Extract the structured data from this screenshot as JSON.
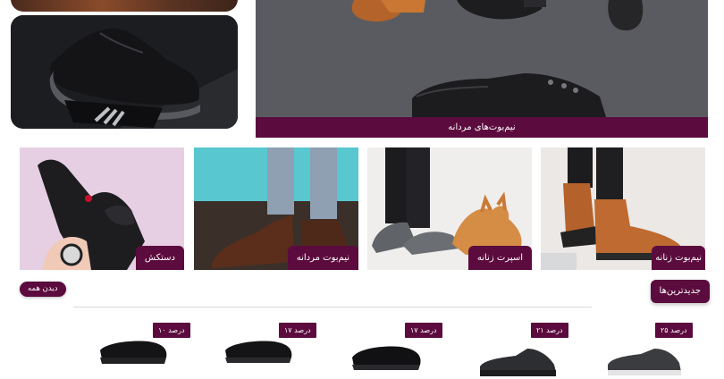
{
  "hero": {
    "caption": "نیم‌بوت‌های مردانه"
  },
  "categories": [
    {
      "label": "نیم‌بوت زنانه"
    },
    {
      "label": "اسپرت زنانه"
    },
    {
      "label": "نیم‌بوت مردانه"
    },
    {
      "label": "دستکش"
    }
  ],
  "newest": {
    "title": "جدیدترین‌ها",
    "see_all": "دیدن همه",
    "products": [
      {
        "discount": "۲۵ درصد"
      },
      {
        "discount": "۲۱ درصد"
      },
      {
        "discount": "۱۷ درصد"
      },
      {
        "discount": "۱۷ درصد"
      },
      {
        "discount": "۱۰ درصد"
      }
    ]
  },
  "colors": {
    "accent": "#5b0b3d"
  }
}
